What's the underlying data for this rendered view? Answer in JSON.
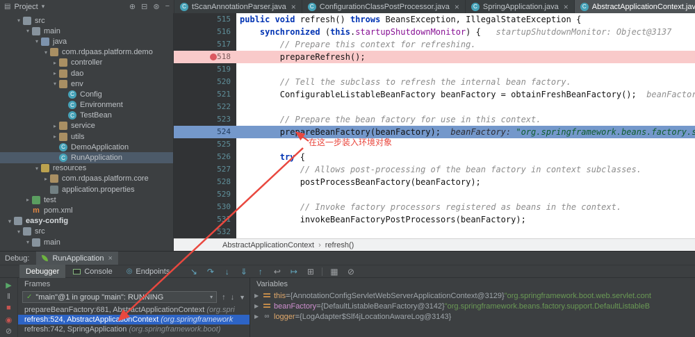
{
  "ui": {
    "close": "×",
    "caretDown": "▾",
    "chevOpen": "▾",
    "chevClosed": "▸",
    "breadcrumbSep": "›"
  },
  "projectPanel": {
    "header": {
      "title": "Project",
      "icons": [
        "locate",
        "collapse-all",
        "settings",
        "hide"
      ]
    },
    "tree": [
      {
        "label": "src",
        "level": 1,
        "chevron": "open",
        "icon": "folder"
      },
      {
        "label": "main",
        "level": 2,
        "chevron": "open",
        "icon": "folder"
      },
      {
        "label": "java",
        "level": 3,
        "chevron": "open",
        "icon": "folder-src"
      },
      {
        "label": "com.rdpaas.platform.demo",
        "level": 4,
        "chevron": "open",
        "icon": "package"
      },
      {
        "label": "controller",
        "level": 5,
        "chevron": "closed",
        "icon": "package"
      },
      {
        "label": "dao",
        "level": 5,
        "chevron": "closed",
        "icon": "package"
      },
      {
        "label": "env",
        "level": 5,
        "chevron": "open",
        "icon": "package"
      },
      {
        "label": "Config",
        "level": 6,
        "chevron": "none",
        "icon": "class"
      },
      {
        "label": "Environment",
        "level": 6,
        "chevron": "none",
        "icon": "class"
      },
      {
        "label": "TestBean",
        "level": 6,
        "chevron": "none",
        "icon": "class"
      },
      {
        "label": "service",
        "level": 5,
        "chevron": "closed",
        "icon": "package"
      },
      {
        "label": "utils",
        "level": 5,
        "chevron": "closed",
        "icon": "package"
      },
      {
        "label": "DemoApplication",
        "level": 5,
        "chevron": "none",
        "icon": "class"
      },
      {
        "label": "RunApplication",
        "level": 5,
        "chevron": "none",
        "icon": "class",
        "selected": true
      },
      {
        "label": "resources",
        "level": 3,
        "chevron": "open",
        "icon": "folder-res"
      },
      {
        "label": "com.rdpaas.platform.core",
        "level": 4,
        "chevron": "closed",
        "icon": "package"
      },
      {
        "label": "application.properties",
        "level": 4,
        "chevron": "none",
        "icon": "props"
      },
      {
        "label": "test",
        "level": 2,
        "chevron": "closed",
        "icon": "folder-test"
      },
      {
        "label": "pom.xml",
        "level": 2,
        "chevron": "none",
        "icon": "maven"
      },
      {
        "label": "easy-config",
        "level": 0,
        "chevron": "open",
        "icon": "folder",
        "bold": true
      },
      {
        "label": "src",
        "level": 1,
        "chevron": "open",
        "icon": "folder"
      },
      {
        "label": "main",
        "level": 2,
        "chevron": "open",
        "icon": "folder"
      }
    ]
  },
  "editorTabs": [
    {
      "label": "tScanAnnotationParser.java",
      "active": false
    },
    {
      "label": "ConfigurationClassPostProcessor.java",
      "active": false
    },
    {
      "label": "SpringApplication.java",
      "active": false
    },
    {
      "label": "AbstractApplicationContext.java",
      "active": true
    }
  ],
  "editor": {
    "lines": [
      {
        "num": "515",
        "segs": [
          [
            "k",
            "public void "
          ],
          [
            "p",
            "refresh() "
          ],
          [
            "k",
            "throws"
          ],
          [
            "p",
            " BeansException, IllegalStateException {"
          ]
        ]
      },
      {
        "num": "516",
        "segs": [
          [
            "p",
            "    "
          ],
          [
            "k",
            "synchronized "
          ],
          [
            "p",
            "("
          ],
          [
            "k",
            "this"
          ],
          [
            "p",
            "."
          ],
          [
            "f",
            "startupShutdownMonitor"
          ],
          [
            "p",
            ") {"
          ],
          [
            "h",
            "   startupShutdownMonitor: Object@3137"
          ]
        ]
      },
      {
        "num": "517",
        "segs": [
          [
            "p",
            "        "
          ],
          [
            "c",
            "// Prepare this context for refreshing."
          ]
        ]
      },
      {
        "num": "518",
        "bg": "breakpoint",
        "marker": "breakpoint",
        "segs": [
          [
            "p",
            "        prepareRefresh();"
          ]
        ]
      },
      {
        "num": "519",
        "segs": []
      },
      {
        "num": "520",
        "segs": [
          [
            "p",
            "        "
          ],
          [
            "c",
            "// Tell the subclass to refresh the internal bean factory."
          ]
        ]
      },
      {
        "num": "521",
        "segs": [
          [
            "p",
            "        ConfigurableListableBeanFactory beanFactory = obtainFreshBeanFactory();"
          ],
          [
            "h",
            "  beanFactory:"
          ]
        ]
      },
      {
        "num": "522",
        "segs": []
      },
      {
        "num": "523",
        "segs": [
          [
            "p",
            "        "
          ],
          [
            "c",
            "// Prepare the bean factory for use in this context."
          ]
        ]
      },
      {
        "num": "524",
        "bg": "exec",
        "segs": [
          [
            "p",
            "        prepareBeanFactory(beanFactory);"
          ],
          [
            "h",
            "  beanFactory: "
          ],
          [
            "hs",
            "\"org.springframework.beans.factory.sup"
          ]
        ]
      },
      {
        "num": "525",
        "segs": []
      },
      {
        "num": "526",
        "segs": [
          [
            "p",
            "        "
          ],
          [
            "k",
            "try"
          ],
          [
            "p",
            " {"
          ]
        ]
      },
      {
        "num": "527",
        "segs": [
          [
            "p",
            "            "
          ],
          [
            "c",
            "// Allows post-processing of the bean factory in context subclasses."
          ]
        ]
      },
      {
        "num": "528",
        "segs": [
          [
            "p",
            "            postProcessBeanFactory(beanFactory);"
          ]
        ]
      },
      {
        "num": "529",
        "segs": []
      },
      {
        "num": "530",
        "segs": [
          [
            "p",
            "            "
          ],
          [
            "c",
            "// Invoke factory processors registered as beans in the context."
          ]
        ]
      },
      {
        "num": "531",
        "segs": [
          [
            "p",
            "            invokeBeanFactoryPostProcessors(beanFactory);"
          ]
        ]
      },
      {
        "num": "532",
        "segs": []
      }
    ],
    "breadcrumb": {
      "items": [
        "AbstractApplicationContext",
        "refresh()"
      ],
      "separator": "›"
    }
  },
  "annotation": {
    "text": "在这一步装入环境对象",
    "color": "#e9483f"
  },
  "debug": {
    "windowLabel": "Debug:",
    "runTab": {
      "label": "RunApplication"
    },
    "viewTabs": [
      {
        "label": "Debugger",
        "active": true,
        "icon": "none"
      },
      {
        "label": "Console",
        "active": false,
        "icon": "console"
      },
      {
        "label": "Endpoints",
        "active": false,
        "icon": "endpoint"
      }
    ],
    "toolbar": [
      "show-execution-point",
      "step-over",
      "step-into",
      "force-step-into",
      "step-out",
      "drop-frame",
      "run-to-cursor",
      "evaluate-expression",
      "sep",
      "layout-settings",
      "mute-breakpoints"
    ],
    "leftBar": [
      "resume",
      "pause",
      "stop",
      "view-breakpoints",
      "mute-breakpoints"
    ],
    "frames": {
      "title": "Frames",
      "thread": {
        "check": "✓",
        "text": "\"main\"@1 in group \"main\": RUNNING"
      },
      "rows": [
        {
          "method": "prepareBeanFactory:681, ",
          "cls": "AbstractApplicationContext ",
          "pkg": "(org.spri",
          "selected": false
        },
        {
          "method": "refresh:524, ",
          "cls": "AbstractApplicationContext ",
          "pkg": "(org.springframework",
          "selected": true
        },
        {
          "method": "refresh:742, ",
          "cls": "SpringApplication ",
          "pkg": "(org.springframework.boot)",
          "selected": false
        }
      ]
    },
    "variables": {
      "title": "Variables",
      "rows": [
        {
          "icon": "value",
          "name": "this",
          "eq": " = ",
          "ref": "{AnnotationConfigServletWebServerApplicationContext@3129} ",
          "str": "\"org.springframework.boot.web.servlet.cont"
        },
        {
          "icon": "value",
          "name": "beanFactory",
          "nameColor": "magenta",
          "eq": " = ",
          "ref": "{DefaultListableBeanFactory@3142} ",
          "str": "\"org.springframework.beans.factory.support.DefaultListableB"
        },
        {
          "icon": "watch",
          "name": "logger",
          "eq": " = ",
          "ref": "{LogAdapter$Slf4jLocationAwareLog@3143}",
          "str": ""
        }
      ]
    }
  }
}
